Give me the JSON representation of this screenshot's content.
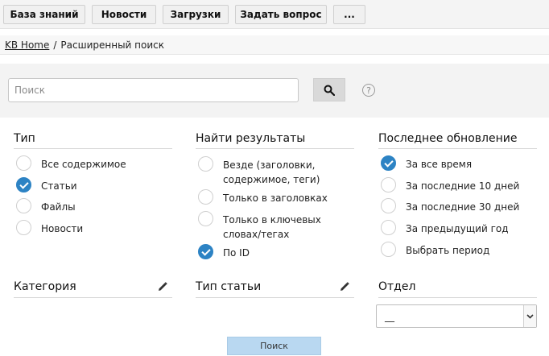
{
  "nav": {
    "items": [
      {
        "label": "База знаний"
      },
      {
        "label": "Новости"
      },
      {
        "label": "Загрузки"
      },
      {
        "label": "Задать вопрос"
      },
      {
        "label": "..."
      }
    ]
  },
  "breadcrumb": {
    "home": "KB Home",
    "separator": "/",
    "current": "Расширенный поиск"
  },
  "search": {
    "placeholder": "Поиск",
    "value": "",
    "button_icon": "search-icon",
    "help_icon": "?"
  },
  "filters": {
    "type": {
      "title": "Тип",
      "options": [
        {
          "label": "Все содержимое",
          "checked": false
        },
        {
          "label": "Статьи",
          "checked": true
        },
        {
          "label": "Файлы",
          "checked": false
        },
        {
          "label": "Новости",
          "checked": false
        }
      ]
    },
    "find": {
      "title": "Найти результаты",
      "options": [
        {
          "label": "Везде (заголовки, содержимое, теги)",
          "checked": false
        },
        {
          "label": "Только в заголовках",
          "checked": false
        },
        {
          "label": "Только в ключевых словах/тегах",
          "checked": false
        },
        {
          "label": "По ID",
          "checked": true
        }
      ]
    },
    "updated": {
      "title": "Последнее обновление",
      "options": [
        {
          "label": "За все время",
          "checked": true
        },
        {
          "label": "За последние 10 дней",
          "checked": false
        },
        {
          "label": "За последние 30 дней",
          "checked": false
        },
        {
          "label": "За предыдущий год",
          "checked": false
        },
        {
          "label": "Выбрать период",
          "checked": false
        }
      ]
    }
  },
  "sections": {
    "category": "Категория",
    "article_type": "Тип статьи",
    "department": "Отдел",
    "department_value": "__"
  },
  "submit_label": "Поиск",
  "colors": {
    "accent": "#2d83c4",
    "submit_bg": "#b9d8f1",
    "panel_bg": "#f3f3f3"
  }
}
